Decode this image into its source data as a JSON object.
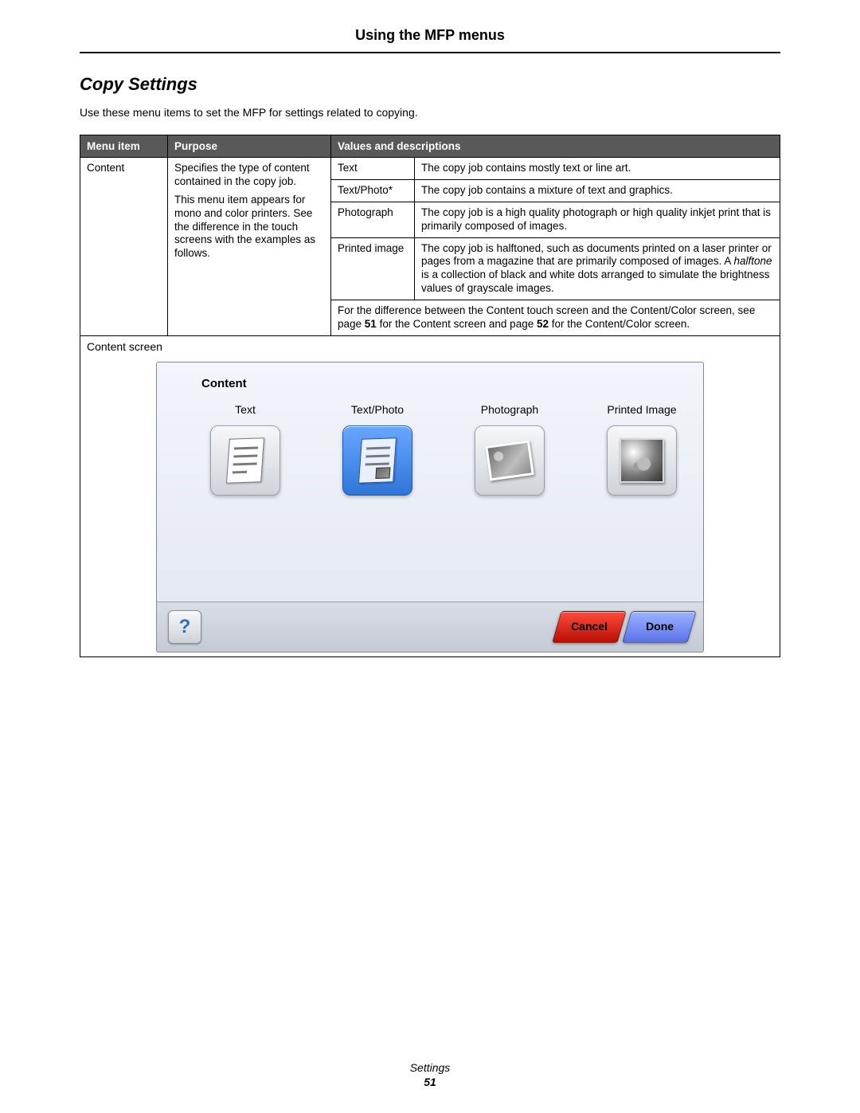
{
  "header": {
    "chapter": "Using the MFP menus"
  },
  "section": {
    "title": "Copy Settings",
    "intro": "Use these menu items to set the MFP for settings related to copying."
  },
  "table": {
    "headers": {
      "menu_item": "Menu item",
      "purpose": "Purpose",
      "values": "Values and descriptions"
    },
    "content_row": {
      "menu_item": "Content",
      "purpose_p1": "Specifies the type of content contained in the copy job.",
      "purpose_p2": "This menu item appears for mono and color printers. See the difference in the touch screens with the examples as follows.",
      "values": {
        "text": {
          "label": "Text",
          "desc": "The copy job contains mostly text or line art."
        },
        "textphoto": {
          "label": "Text/Photo*",
          "desc": "The copy job contains a mixture of text and graphics."
        },
        "photograph": {
          "label": "Photograph",
          "desc": "The copy job is a high quality photograph or high quality inkjet print that is primarily composed of images."
        },
        "printed": {
          "label": "Printed image",
          "desc_part1": "The copy job is halftoned, such as documents printed on a laser printer or pages from a magazine that are primarily composed of images. A ",
          "halftone_word": "halftone",
          "desc_part2": " is a collection of black and white dots arranged to simulate the brightness values of grayscale images.",
          "note_part1": "For the difference between the Content touch screen and the Content/Color screen, see page ",
          "ref51": "51",
          "note_part2": " for the Content screen and page ",
          "ref52": "52",
          "note_part3": " for the Content/Color screen."
        }
      }
    },
    "screen_row": {
      "label": "Content screen"
    }
  },
  "touchscreen": {
    "heading": "Content",
    "options": {
      "text": "Text",
      "textphoto": "Text/Photo",
      "photograph": "Photograph",
      "printed": "Printed Image"
    },
    "buttons": {
      "help": "?",
      "cancel": "Cancel",
      "done": "Done"
    }
  },
  "footer": {
    "label": "Settings",
    "page": "51"
  }
}
